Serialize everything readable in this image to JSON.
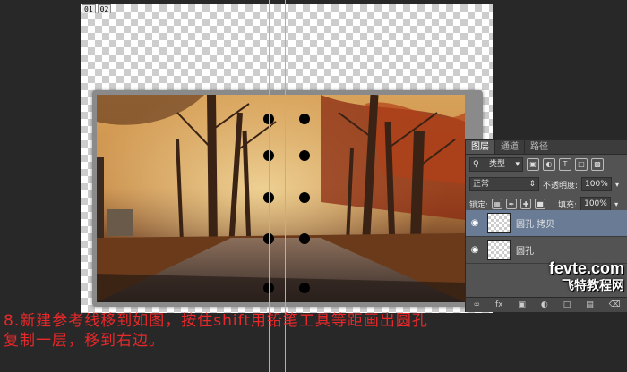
{
  "document": {
    "tab_labels": [
      "01",
      "02"
    ]
  },
  "layers_panel": {
    "tabs": [
      "图层",
      "通道",
      "路径"
    ],
    "filter_kind": "类型",
    "blend_mode": "正常",
    "opacity_label": "不透明度:",
    "opacity_value": "100%",
    "lock_label": "锁定:",
    "fill_label": "填充:",
    "fill_value": "100%",
    "layers": [
      {
        "name": "圆孔 拷贝",
        "selected": true
      },
      {
        "name": "圆孔",
        "selected": false
      }
    ],
    "footer_icons": [
      "link-icon",
      "fx",
      "mask-icon",
      "adjustment-icon",
      "folder-icon",
      "new-layer-icon",
      "trash-icon"
    ]
  },
  "watermark": {
    "line1": "fevte.com",
    "line2": "飞特教程网"
  },
  "caption": {
    "line1": "8.新建参考线移到如图，按住shift用铅笔工具等距画出圆孔",
    "line2": "复制一层，移到右边。"
  },
  "colors": {
    "guide": "#40e0e0",
    "caption": "#e8282a",
    "selected_layer": "#697b95"
  }
}
